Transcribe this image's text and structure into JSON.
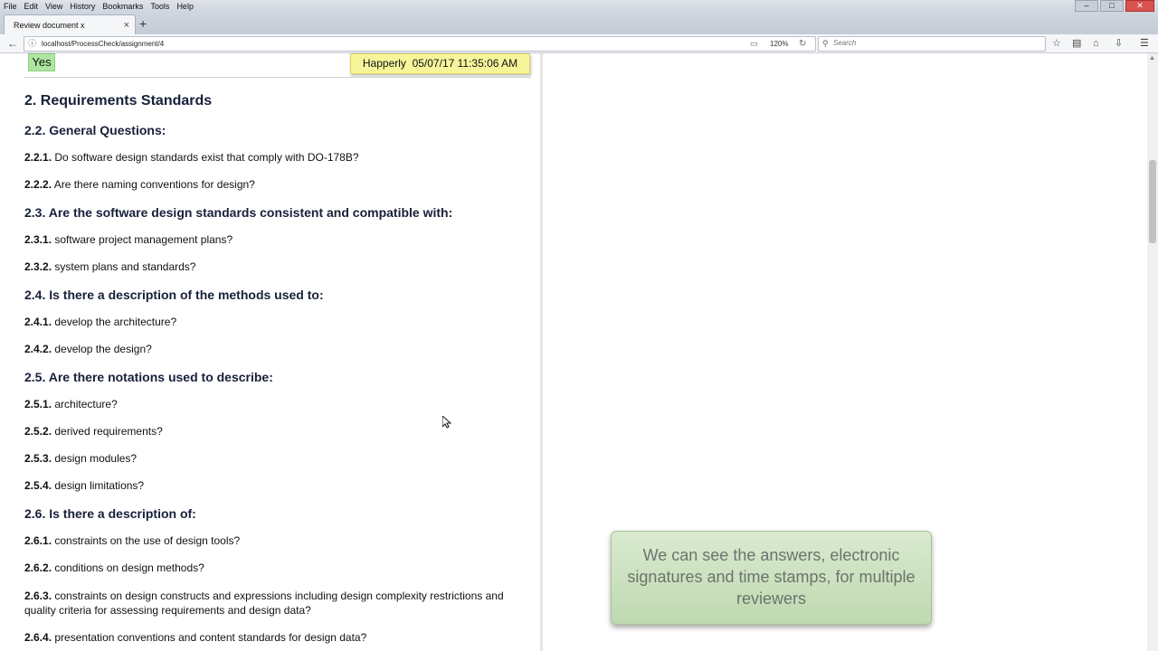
{
  "menu": {
    "items": [
      "File",
      "Edit",
      "View",
      "History",
      "Bookmarks",
      "Tools",
      "Help"
    ]
  },
  "tab": {
    "title": "Review document x"
  },
  "address": {
    "url": "localhost/ProcessCheck/assignment/4",
    "zoom": "120%"
  },
  "search": {
    "placeholder": "Search"
  },
  "answer": {
    "value": "Yes"
  },
  "signature": {
    "reviewer": "Happerly",
    "timestamp": "05/07/17 11:35:06 AM"
  },
  "section": {
    "title": "2. Requirements Standards",
    "groups": [
      {
        "heading": "2.2. General Questions:"
      },
      {
        "heading": "2.3. Are the software design standards consistent and compatible with:"
      },
      {
        "heading": "2.4. Is there a description of the methods used to:"
      },
      {
        "heading": "2.5. Are there notations used to describe:"
      },
      {
        "heading": "2.6. Is there a description of:"
      }
    ],
    "questions": [
      {
        "num": "2.2.1.",
        "text": "Do software design standards exist that comply with DO-178B?"
      },
      {
        "num": "2.2.2.",
        "text": "Are there naming conventions for design?"
      },
      {
        "num": "2.3.1.",
        "text": "software project management plans?"
      },
      {
        "num": "2.3.2.",
        "text": "system plans and standards?"
      },
      {
        "num": "2.4.1.",
        "text": "develop the architecture?"
      },
      {
        "num": "2.4.2.",
        "text": "develop the design?"
      },
      {
        "num": "2.5.1.",
        "text": "architecture?"
      },
      {
        "num": "2.5.2.",
        "text": "derived requirements?"
      },
      {
        "num": "2.5.3.",
        "text": "design modules?"
      },
      {
        "num": "2.5.4.",
        "text": "design limitations?"
      },
      {
        "num": "2.6.1.",
        "text": "constraints on the use of design tools?"
      },
      {
        "num": "2.6.2.",
        "text": "conditions on design methods?"
      },
      {
        "num": "2.6.3.",
        "text": "constraints on design constructs and expressions including design complexity restrictions and quality criteria for assessing requirements and design data?"
      },
      {
        "num": "2.6.4.",
        "text": "presentation conventions and content standards for design data?"
      }
    ]
  },
  "callout": {
    "text": "We can see the answers, electronic signatures and time stamps, for multiple reviewers"
  }
}
